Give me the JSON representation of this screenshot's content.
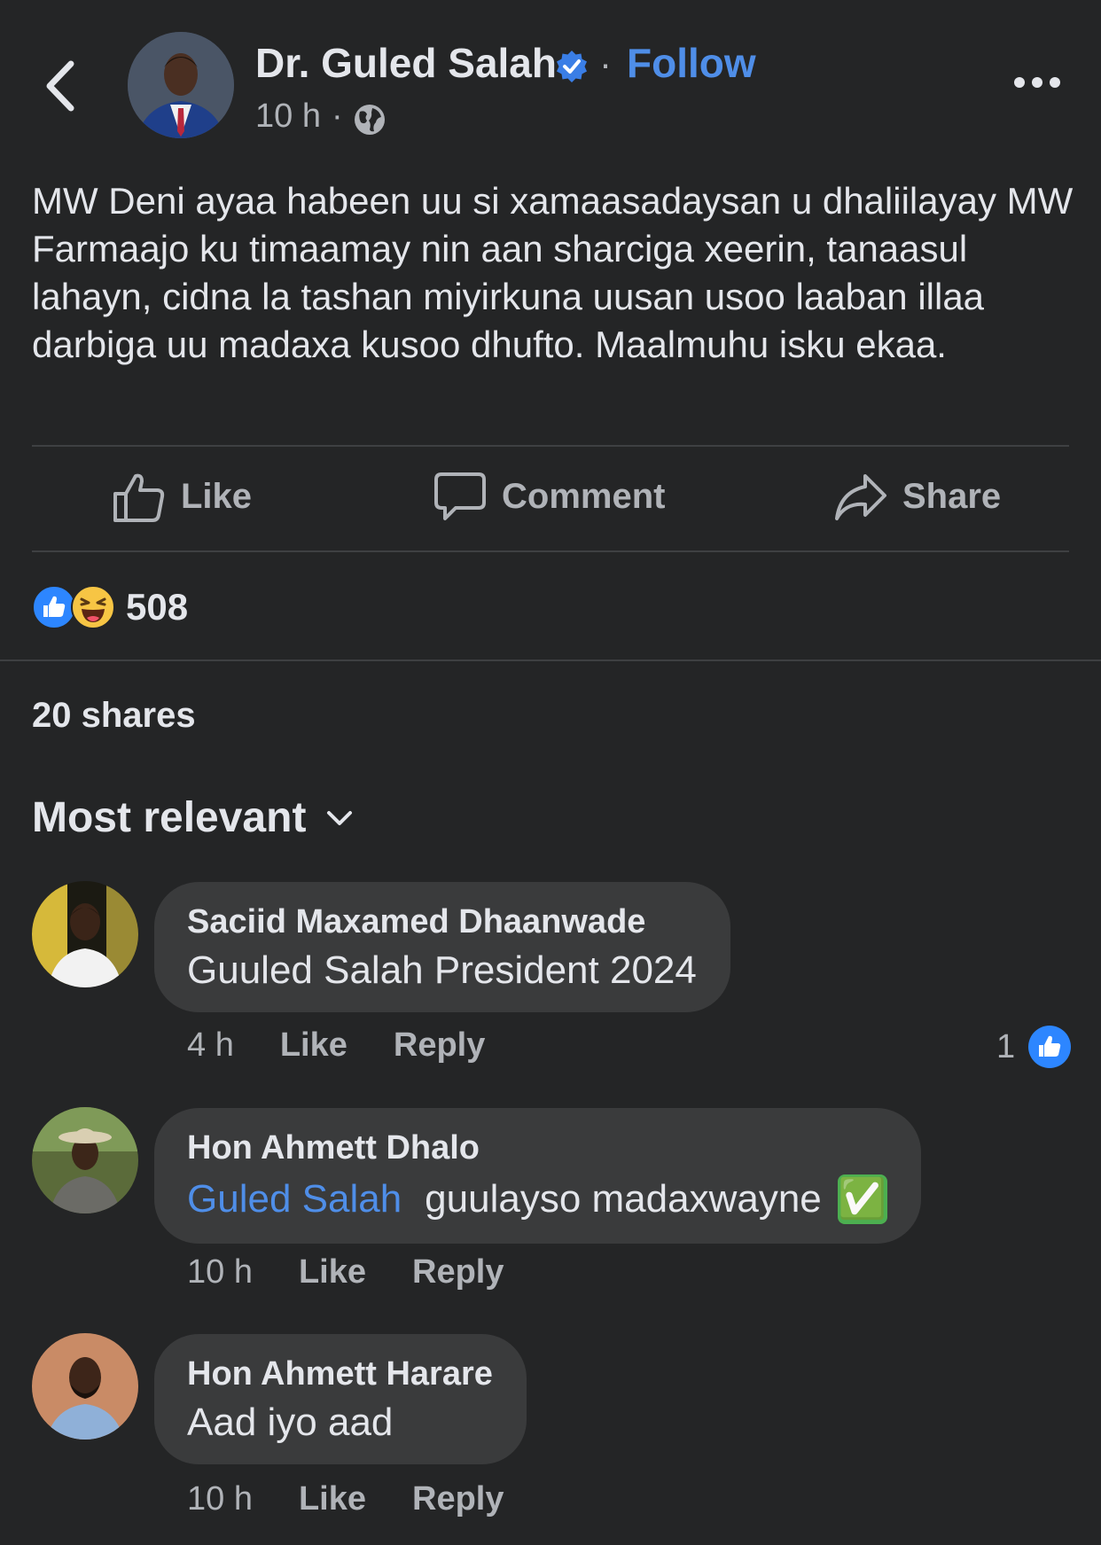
{
  "post": {
    "author": "Dr. Guled Salah",
    "verified": true,
    "separator": "·",
    "follow_label": "Follow",
    "time": "10 h",
    "time_separator": "·",
    "privacy_icon": "globe-icon",
    "text": "MW Deni ayaa habeen uu si xamaasadaysan u dhaliilayay MW Farmaajo ku timaamay nin aan sharciga xeerin, tanaasul lahayn, cidna la tashan miyirkuna uusan usoo laaban illaa darbiga uu madaxa kusoo dhufto. Maalmuhu isku ekaa."
  },
  "actions": {
    "like_label": "Like",
    "comment_label": "Comment",
    "share_label": "Share"
  },
  "reactions": {
    "types": [
      "like",
      "haha"
    ],
    "count": "508"
  },
  "shares": "20 shares",
  "sort": {
    "label": "Most relevant"
  },
  "comments": [
    {
      "name": "Saciid Maxamed Dhaanwade",
      "text": "Guuled Salah President 2024",
      "time": "4 h",
      "like_label": "Like",
      "reply_label": "Reply",
      "reaction_count": "1"
    },
    {
      "name": "Hon Ahmett Dhalo",
      "mention": "Guled Salah",
      "text": "guulayso madaxwayne",
      "emoji": "✅",
      "time": "10 h",
      "like_label": "Like",
      "reply_label": "Reply"
    },
    {
      "name": "Hon Ahmett Harare",
      "text": "Aad iyo aad",
      "time": "10 h",
      "like_label": "Like",
      "reply_label": "Reply"
    }
  ],
  "colors": {
    "background": "#242526",
    "bubble": "#3a3b3c",
    "accent_blue": "#4f8ee8",
    "secondary_text": "#b0b3b8"
  }
}
